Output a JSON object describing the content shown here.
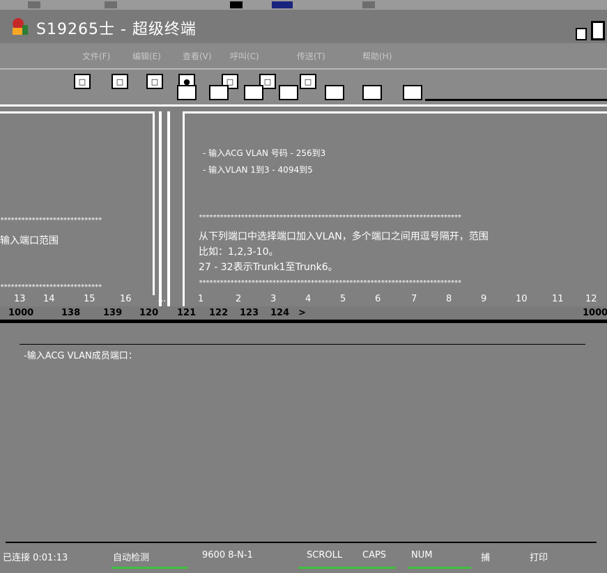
{
  "window": {
    "title": "S19265士 - 超级终端",
    "min_label": "_",
    "max_label": ""
  },
  "menubar": {
    "items": [
      "文件(F)",
      "编辑(E)",
      "查看(V)",
      "呼叫(C)",
      "传送(T)",
      "帮助(H)"
    ]
  },
  "toolbar": {
    "buttons": [
      "□",
      "□",
      "□",
      "●",
      "□",
      "□",
      "□"
    ]
  },
  "hints": {
    "line1": "- 输入ACG VLAN 号码 - 256到3",
    "line2": "- 输入VLAN 1到3 - 4094到5"
  },
  "left_panel": {
    "stars_top": "*****************************",
    "heading": "输入端口范围",
    "stars_bottom": "*****************************"
  },
  "right_panel": {
    "stars_top": "***************************************************************************",
    "line1": "从下列端口中选择端口加入VLAN，多个端口之间用逗号隔开，范围",
    "line2": "比如：1,2,3-10。",
    "line3": "27 - 32表示Trunk1至Trunk6。",
    "stars_bottom": "***************************************************************************"
  },
  "ports": {
    "left": [
      "13",
      "14",
      "15",
      "16",
      "..."
    ],
    "right": [
      "1",
      "2",
      "3",
      "4",
      "5",
      "6",
      "7",
      "8",
      "9",
      "10",
      "11",
      "12"
    ]
  },
  "vlan_row": {
    "items": [
      "1000",
      "138",
      "139",
      "120",
      "121",
      "122",
      "123",
      "124",
      ">"
    ],
    "right_end": "1000"
  },
  "prompt": {
    "text": "-输入ACG VLAN成员端口："
  },
  "statusbar": {
    "items": [
      "已连接 0:01:13",
      "自动检测",
      "9600 8-N-1",
      "SCROLL",
      "CAPS",
      "NUM",
      "捕",
      "打印"
    ]
  },
  "colors": {
    "background": "#808080",
    "foreground": "#ffffff",
    "status_accent": "#3fbf3f"
  }
}
